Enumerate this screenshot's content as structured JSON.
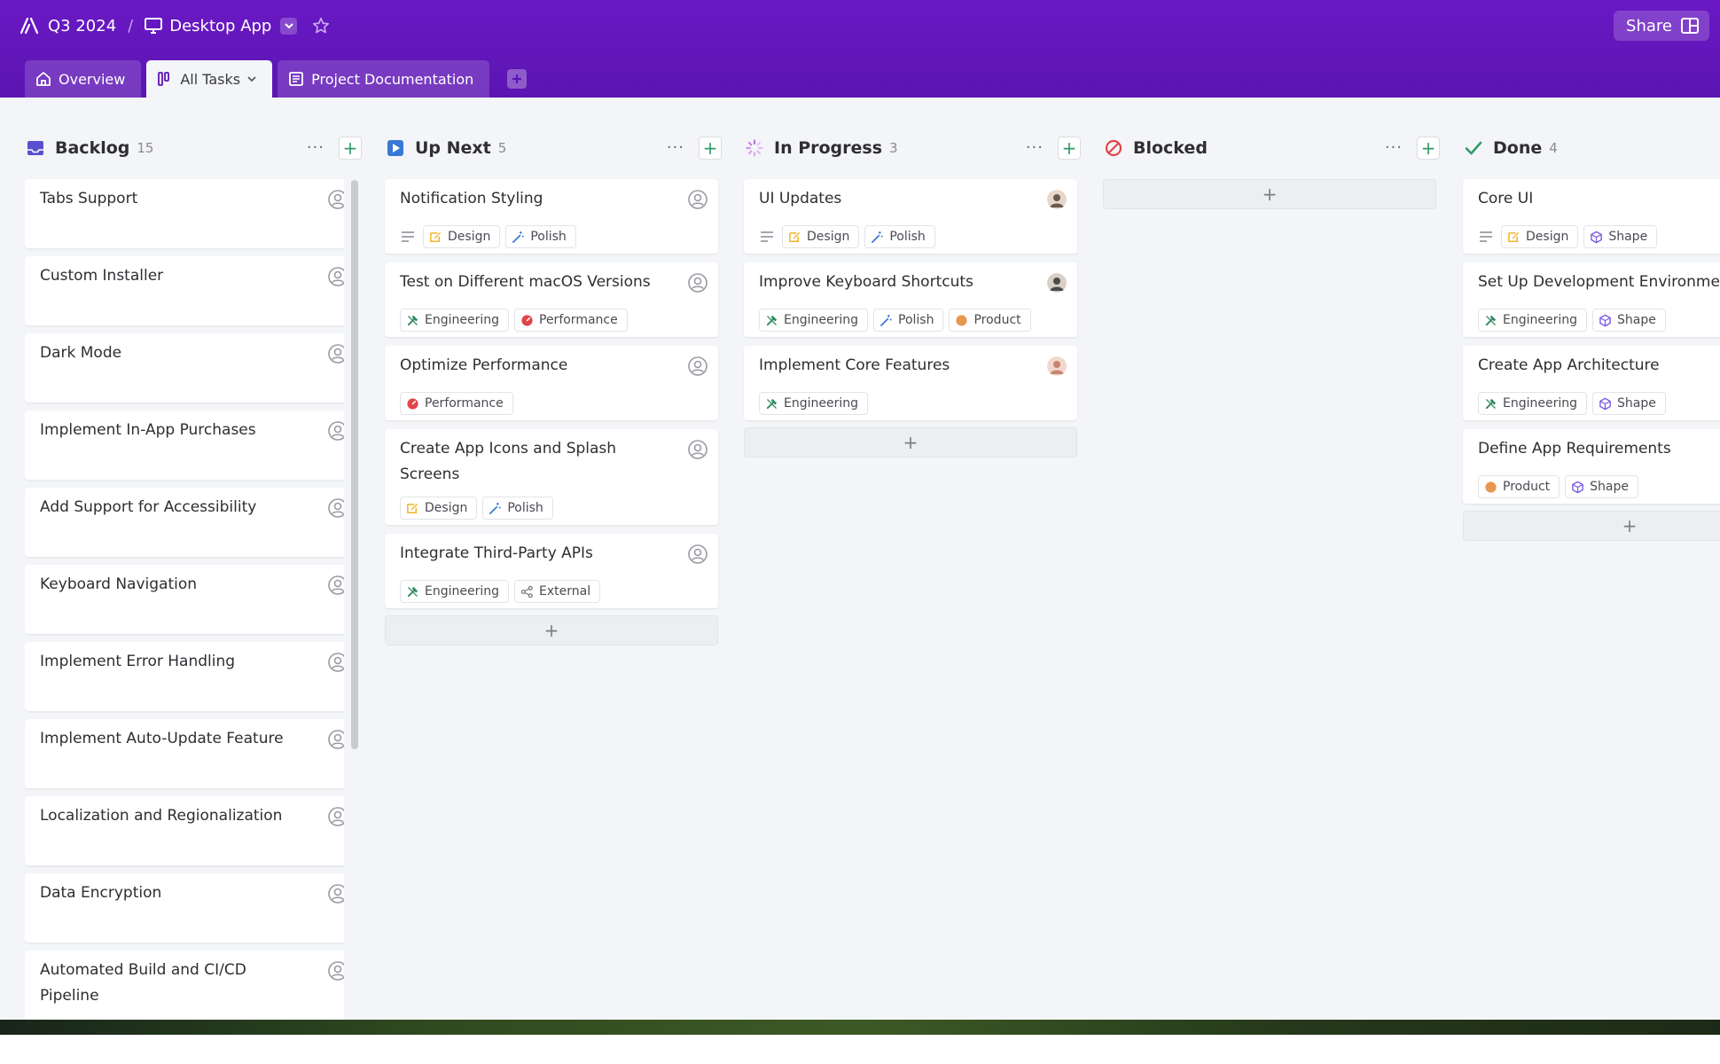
{
  "breadcrumb": {
    "project": "Q3 2024",
    "separator": "/",
    "board": "Desktop App"
  },
  "topbar": {
    "share_label": "Share"
  },
  "tabs": [
    {
      "label": "Overview",
      "icon": "home-icon",
      "active": false
    },
    {
      "label": "All Tasks",
      "icon": "board-icon",
      "active": true
    },
    {
      "label": "Project Documentation",
      "icon": "document-icon",
      "active": false
    }
  ],
  "columns": {
    "backlog": {
      "title": "Backlog",
      "count": "15",
      "color": "#5a4fcf",
      "cards": [
        {
          "title": "Tabs Support"
        },
        {
          "title": "Custom Installer"
        },
        {
          "title": "Dark Mode"
        },
        {
          "title": "Implement In-App Purchases"
        },
        {
          "title": "Add Support for Accessibility"
        },
        {
          "title": "Keyboard Navigation"
        },
        {
          "title": "Implement Error Handling"
        },
        {
          "title": "Implement Auto-Update Feature"
        },
        {
          "title": "Localization and Regionalization"
        },
        {
          "title": "Data Encryption"
        },
        {
          "title": "Automated Build and CI/CD Pipeline"
        }
      ]
    },
    "up_next": {
      "title": "Up Next",
      "count": "5",
      "color": "#3a78d6",
      "cards": [
        {
          "title": "Notification Styling",
          "tags": [
            "Design",
            "Polish"
          ]
        },
        {
          "title": "Test on Different macOS Versions",
          "tags": [
            "Engineering",
            "Performance"
          ]
        },
        {
          "title": "Optimize Performance",
          "tags": [
            "Performance"
          ]
        },
        {
          "title": "Create App Icons and Splash Screens",
          "tags": [
            "Design",
            "Polish"
          ]
        },
        {
          "title": "Integrate Third-Party APIs",
          "tags": [
            "Engineering",
            "External"
          ]
        }
      ]
    },
    "in_progress": {
      "title": "In Progress",
      "count": "3",
      "color": "#c070e0",
      "cards": [
        {
          "title": "UI Updates",
          "tags": [
            "Design",
            "Polish"
          ]
        },
        {
          "title": "Improve Keyboard Shortcuts",
          "tags": [
            "Engineering",
            "Polish",
            "Product"
          ]
        },
        {
          "title": "Implement Core Features",
          "tags": [
            "Engineering"
          ]
        }
      ]
    },
    "blocked": {
      "title": "Blocked",
      "count": "",
      "color": "#e0454a",
      "cards": []
    },
    "done": {
      "title": "Done",
      "count": "4",
      "color": "#2e9b6a",
      "cards": [
        {
          "title": "Core UI",
          "tags": [
            "Design",
            "Shape"
          ]
        },
        {
          "title": "Set Up Development Environment",
          "tags": [
            "Engineering",
            "Shape"
          ]
        },
        {
          "title": "Create App Architecture",
          "tags": [
            "Engineering",
            "Shape"
          ]
        },
        {
          "title": "Define App Requirements",
          "tags": [
            "Product",
            "Shape"
          ]
        }
      ]
    }
  },
  "tag_colors": {
    "Design": "#f0b429",
    "Polish": "#3a78d6",
    "Engineering": "#2e8a5e",
    "Performance": "#e0454a",
    "Product": "#e8974f",
    "External": "#7c7c84",
    "Shape": "#7b5ce0"
  },
  "add_symbol": "+",
  "more_symbol": "···"
}
